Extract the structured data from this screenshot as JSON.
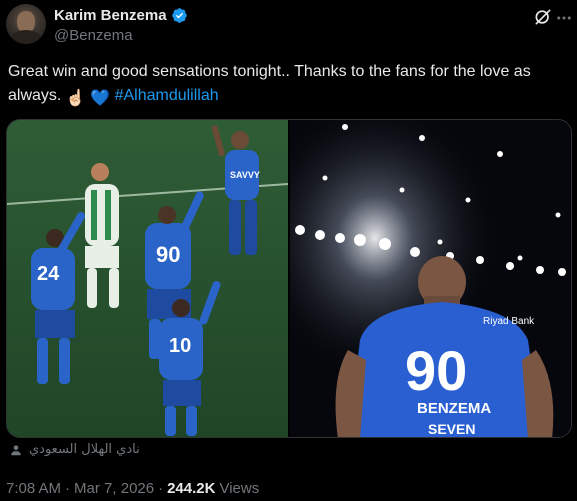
{
  "author": {
    "display_name": "Karim Benzema",
    "handle": "@Benzema",
    "verified_icon": "verified-badge-icon",
    "avatar_icon": "avatar"
  },
  "header_actions": {
    "grok_icon": "grok-icon",
    "more_icon": "more-options-icon"
  },
  "tweet": {
    "text_main": "Great win and good sensations tonight.. Thanks to the fans for the love as always.",
    "emoji_1": "☝🏻",
    "emoji_2": "💙",
    "hashtag": "#Alhamdulillah"
  },
  "media": {
    "left_photo": {
      "jersey_numbers": [
        "24",
        "90",
        "10"
      ],
      "jersey_sponsor": "SAVVY"
    },
    "right_photo": {
      "jersey_number": "90",
      "jersey_name": "BENZEMA",
      "sponsor_top": "Riyad Bank",
      "sponsor_bottom": "SEVEN"
    }
  },
  "source": {
    "icon": "person-tag-icon",
    "label": "نادي الهلال السعودي"
  },
  "meta": {
    "time": "7:08 AM",
    "separator": "·",
    "date": "Mar 7, 2026",
    "views_count": "244.2K",
    "views_label": "Views"
  },
  "colors": {
    "background": "#000000",
    "text_primary": "#e7e9ea",
    "text_secondary": "#71767b",
    "accent": "#1d9bf0",
    "verified": "#1d9bf0"
  }
}
